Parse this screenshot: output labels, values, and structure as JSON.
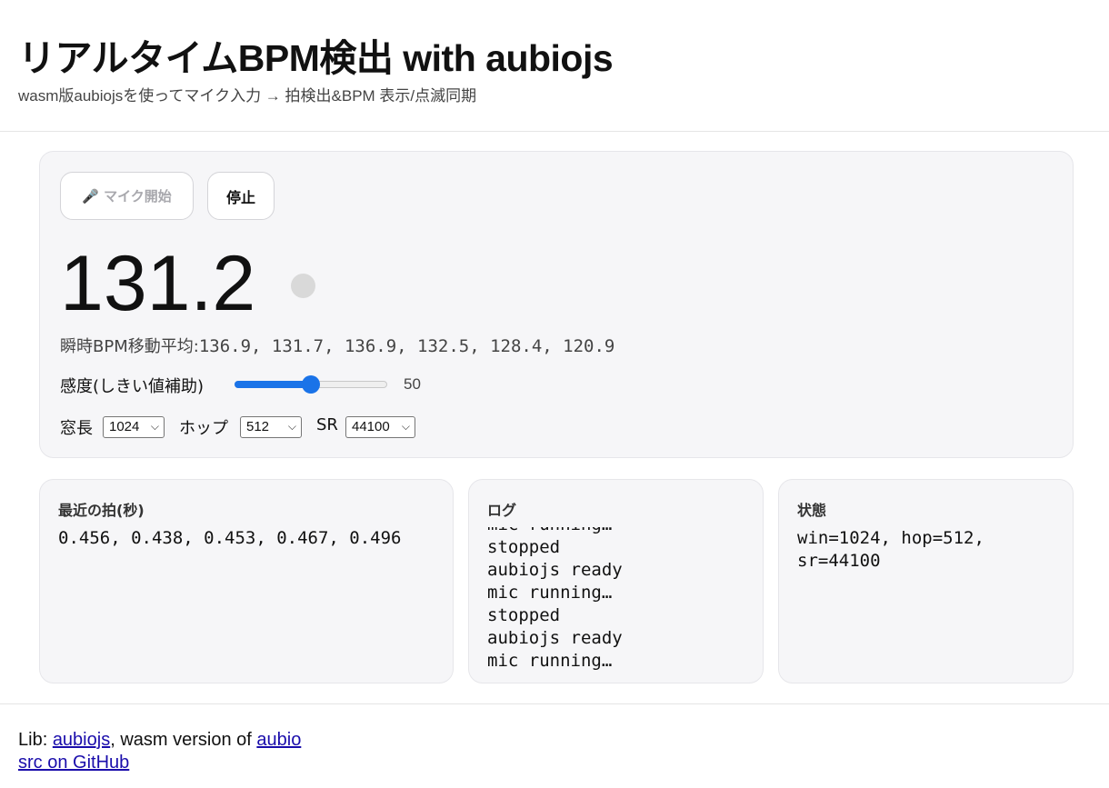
{
  "header": {
    "title": "リアルタイムBPM検出 with aubiojs",
    "subtitle": "wasm版aubiojsを使ってマイク入力 → 拍検出&BPM 表示/点滅同期"
  },
  "controls": {
    "start_label": "🎤 マイク開始",
    "start_disabled": true,
    "stop_label": "停止"
  },
  "display": {
    "bpm": "131.2",
    "beat_indicator_active": false,
    "moving_avg_label": "瞬時BPM移動平均:",
    "moving_avg_values": "136.9, 131.7, 136.9, 132.5, 128.4, 120.9"
  },
  "sensitivity": {
    "label": "感度(しきい値補助)",
    "value": "50",
    "min": 0,
    "max": 100
  },
  "options": {
    "window_label": "窓長",
    "window_value": "1024",
    "hop_label": "ホップ",
    "hop_value": "512",
    "sr_label": "SR",
    "sr_value": "44100"
  },
  "beats_card": {
    "title": "最近の拍(秒)",
    "body": "0.456, 0.438, 0.453, 0.467, 0.496"
  },
  "log_card": {
    "title": "ログ",
    "lines": [
      "mic running…",
      "stopped",
      "aubiojs ready",
      "mic running…",
      "stopped",
      "aubiojs ready",
      "mic running…"
    ]
  },
  "state_card": {
    "title": "状態",
    "body": "win=1024, hop=512,\nsr=44100"
  },
  "footer": {
    "lib_prefix": "Lib: ",
    "aubiojs_link": "aubiojs",
    "middle_text": ", wasm version of ",
    "aubio_link": "aubio",
    "github_link": "src on GitHub"
  },
  "colors": {
    "accent": "#1a73e8",
    "panel_bg": "#f6f6f8",
    "link": "#1a0dab",
    "beat_dot": "#d9d9d9"
  }
}
